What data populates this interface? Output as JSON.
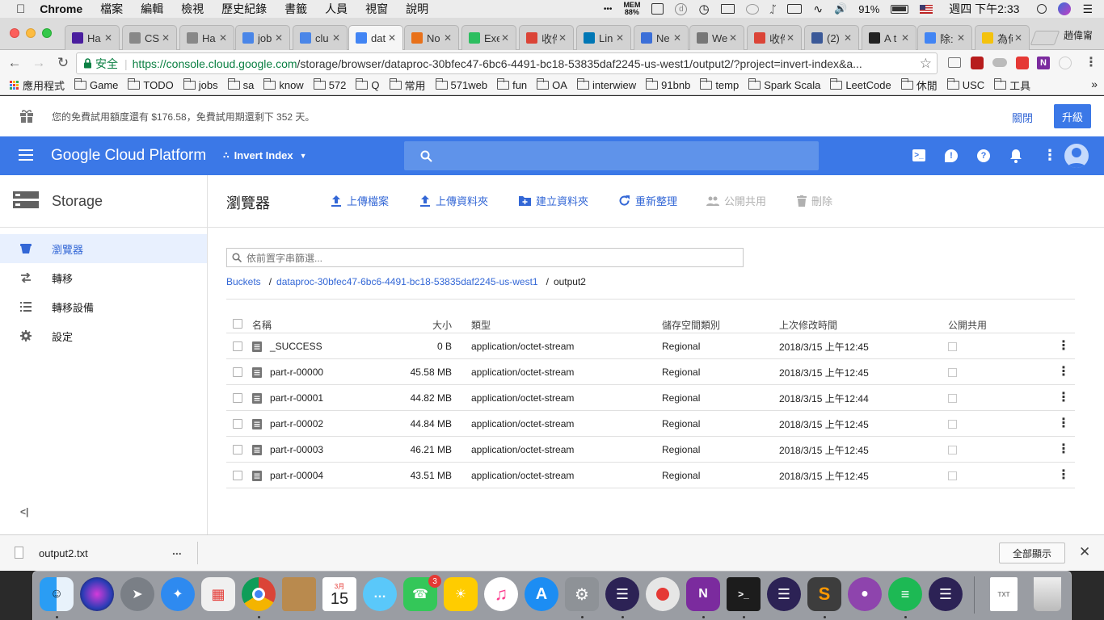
{
  "menubar": {
    "app_name": "Chrome",
    "menus": [
      "檔案",
      "編輯",
      "檢視",
      "歷史紀錄",
      "書籤",
      "人員",
      "視窗",
      "說明"
    ],
    "mem_label": "MEM",
    "mem_value": "88%",
    "battery": "91%",
    "clock": "週四 下午2:33"
  },
  "tabs": [
    {
      "label": "Ha",
      "icon": "yahoo-icon",
      "color": "#4a1e9e"
    },
    {
      "label": "CS",
      "icon": "page-icon",
      "color": "#888888"
    },
    {
      "label": "Ha",
      "icon": "page-icon",
      "color": "#888888"
    },
    {
      "label": "job",
      "icon": "network-icon",
      "color": "#4a86e8"
    },
    {
      "label": "clu",
      "icon": "network-icon",
      "color": "#4a86e8"
    },
    {
      "label": "dat",
      "icon": "storage-icon",
      "color": "#4285f4",
      "active": true
    },
    {
      "label": "No",
      "icon": "stack-icon",
      "color": "#e8711a"
    },
    {
      "label": "Exe",
      "icon": "evernote-icon",
      "color": "#2dbe60"
    },
    {
      "label": "收件",
      "icon": "gmail-icon",
      "color": "#db4437"
    },
    {
      "label": "Lin",
      "icon": "linkedin-icon",
      "color": "#0077b5"
    },
    {
      "label": "Ne",
      "icon": "car-icon",
      "color": "#3b6fd8"
    },
    {
      "label": "We",
      "icon": "wiki-icon",
      "color": "#777777"
    },
    {
      "label": "收件",
      "icon": "gmail-icon",
      "color": "#db4437"
    },
    {
      "label": "(2)",
      "icon": "facebook-icon",
      "color": "#3b5998"
    },
    {
      "label": "A t",
      "icon": "github-icon",
      "color": "#222222"
    },
    {
      "label": "除:",
      "icon": "google-icon",
      "color": "#4285f4"
    },
    {
      "label": "為何",
      "icon": "sun-icon",
      "color": "#f4c20d"
    }
  ],
  "profile_name": "趙偉甯",
  "omnibox": {
    "secure_label": "安全",
    "url_host": "https://console.cloud.google.com",
    "url_path": "/storage/browser/dataproc-30bfec47-6bc6-4491-bc18-53835daf2245-us-west1/output2/?project=invert-index&a..."
  },
  "bookmarks": {
    "apps_label": "應用程式",
    "folders": [
      "Game",
      "TODO",
      "jobs",
      "sa",
      "know",
      "572",
      "Q",
      "常用",
      "571web",
      "fun",
      "OA",
      "interwiew",
      "91bnb",
      "temp",
      "Spark Scala",
      "LeetCode",
      "休閒",
      "USC",
      "工具"
    ],
    "overflow": "»"
  },
  "trial": {
    "message": "您的免費試用額度還有 $176.58，免費試用期還剩下 352 天。",
    "close_label": "關閉",
    "upgrade_label": "升級"
  },
  "gcp": {
    "logo": "Google Cloud Platform",
    "project": "Invert Index"
  },
  "sidebar": {
    "title": "Storage",
    "items": [
      {
        "label": "瀏覽器",
        "icon": "bucket-icon",
        "active": true
      },
      {
        "label": "轉移",
        "icon": "transfer-icon"
      },
      {
        "label": "轉移設備",
        "icon": "list-icon"
      },
      {
        "label": "設定",
        "icon": "gear-icon"
      }
    ],
    "collapse": "<|"
  },
  "main": {
    "title": "瀏覽器",
    "actions": [
      {
        "label": "上傳檔案",
        "icon": "upload-icon",
        "enabled": true
      },
      {
        "label": "上傳資料夾",
        "icon": "upload-folder-icon",
        "enabled": true
      },
      {
        "label": "建立資料夾",
        "icon": "create-folder-icon",
        "enabled": true
      },
      {
        "label": "重新整理",
        "icon": "refresh-icon",
        "enabled": true
      },
      {
        "label": "公開共用",
        "icon": "people-icon",
        "enabled": false
      },
      {
        "label": "刪除",
        "icon": "trash-icon",
        "enabled": false
      }
    ],
    "filter_placeholder": "依前置字串篩選...",
    "breadcrumb": {
      "root": "Buckets",
      "bucket": "dataproc-30bfec47-6bc6-4491-bc18-53835daf2245-us-west1",
      "folder": "output2"
    },
    "columns": [
      "名稱",
      "大小",
      "類型",
      "儲存空間類別",
      "上次修改時間",
      "公開共用"
    ],
    "rows": [
      {
        "name": "_SUCCESS",
        "size": "0 B",
        "type": "application/octet-stream",
        "class": "Regional",
        "modified": "2018/3/15 上午12:45"
      },
      {
        "name": "part-r-00000",
        "size": "45.58 MB",
        "type": "application/octet-stream",
        "class": "Regional",
        "modified": "2018/3/15 上午12:45"
      },
      {
        "name": "part-r-00001",
        "size": "44.82 MB",
        "type": "application/octet-stream",
        "class": "Regional",
        "modified": "2018/3/15 上午12:44"
      },
      {
        "name": "part-r-00002",
        "size": "44.84 MB",
        "type": "application/octet-stream",
        "class": "Regional",
        "modified": "2018/3/15 上午12:45"
      },
      {
        "name": "part-r-00003",
        "size": "46.21 MB",
        "type": "application/octet-stream",
        "class": "Regional",
        "modified": "2018/3/15 上午12:45"
      },
      {
        "name": "part-r-00004",
        "size": "43.51 MB",
        "type": "application/octet-stream",
        "class": "Regional",
        "modified": "2018/3/15 上午12:45"
      }
    ]
  },
  "downloads": {
    "file": "output2.txt",
    "more": "...",
    "show_all": "全部顯示"
  },
  "dock": {
    "calendar_month": "3月",
    "calendar_day": "15",
    "messages_badge": "3"
  },
  "colors": {
    "gcp_blue": "#3b78e7",
    "link_blue": "#3367d6",
    "secure_green": "#0b8043"
  }
}
